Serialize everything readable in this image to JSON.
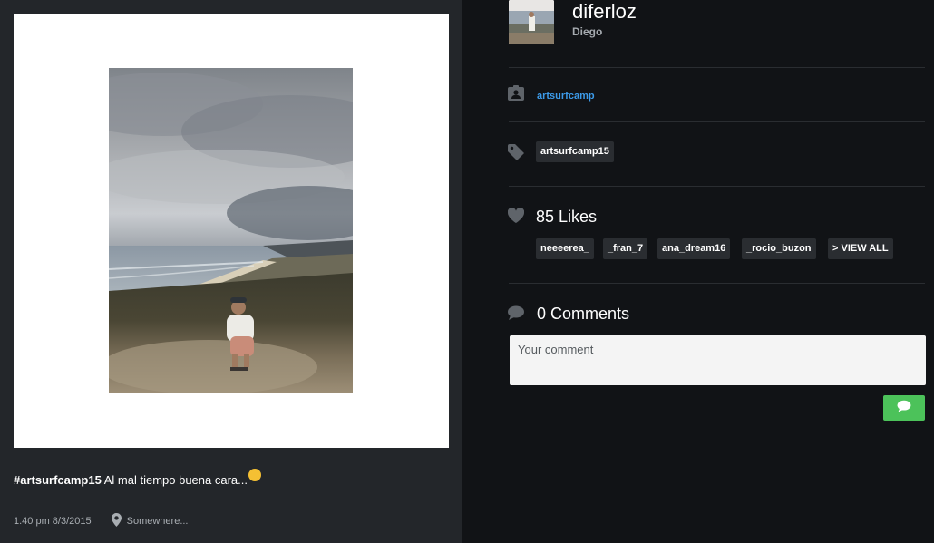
{
  "post": {
    "caption_tag": "#artsurfcamp15",
    "caption_text": "Al mal tiempo buena cara...",
    "caption_emoji": "relieved-face-emoji",
    "time": "1.40 pm 8/3/2015",
    "location": "Somewhere..."
  },
  "user": {
    "username": "diferloz",
    "full_name": "Diego"
  },
  "album": {
    "label": "artsurfcamp",
    "icon": "contact-card-icon"
  },
  "tags": {
    "icon": "tag-icon",
    "items": [
      "artsurfcamp15"
    ]
  },
  "likes": {
    "icon": "heart-icon",
    "count_label": "85 Likes",
    "users": [
      "neeeerea_",
      "_fran_7",
      "ana_dream16",
      "_rocio_buzon"
    ],
    "view_all_label": "> VIEW ALL"
  },
  "comments": {
    "icon": "speech-bubble-icon",
    "count_label": "0 Comments",
    "placeholder": "Your comment",
    "send_icon": "speech-bubble-icon"
  },
  "colors": {
    "left_bg": "#23262a",
    "right_bg": "#111316",
    "link": "#3c9ae8",
    "send_button": "#4cc25a"
  }
}
